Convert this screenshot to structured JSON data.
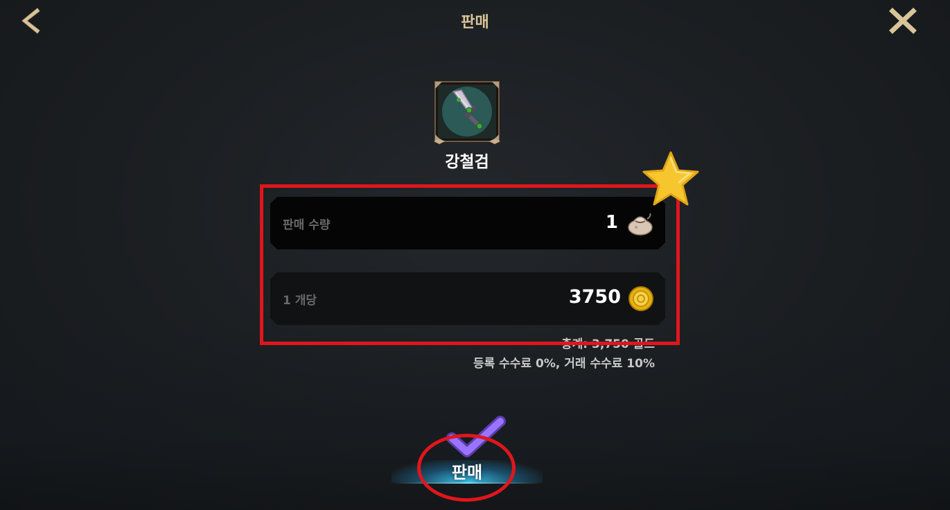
{
  "header": {
    "title": "판매",
    "back_icon": "chevron-left-icon",
    "close_icon": "close-icon"
  },
  "item": {
    "name": "강철검",
    "icon": "sword-icon"
  },
  "quantity_panel": {
    "label": "판매 수량",
    "value": "1",
    "icon": "pouch-icon"
  },
  "price_panel": {
    "label": "1 개당",
    "value": "3750",
    "icon": "gold-coin-icon"
  },
  "summary": {
    "total": "총계: 3,750 골드",
    "fees": "등록 수수료 0%, 거래 수수료 10%"
  },
  "sell_button": {
    "label": "판매"
  },
  "annotations": {
    "highlight_color": "#e0161c",
    "star_color": "#f7c62f",
    "check_color": "#8a5cf0"
  },
  "colors": {
    "title": "#d9c49a",
    "accent_glow": "#3ac8f0",
    "background": "#1b1e21"
  }
}
